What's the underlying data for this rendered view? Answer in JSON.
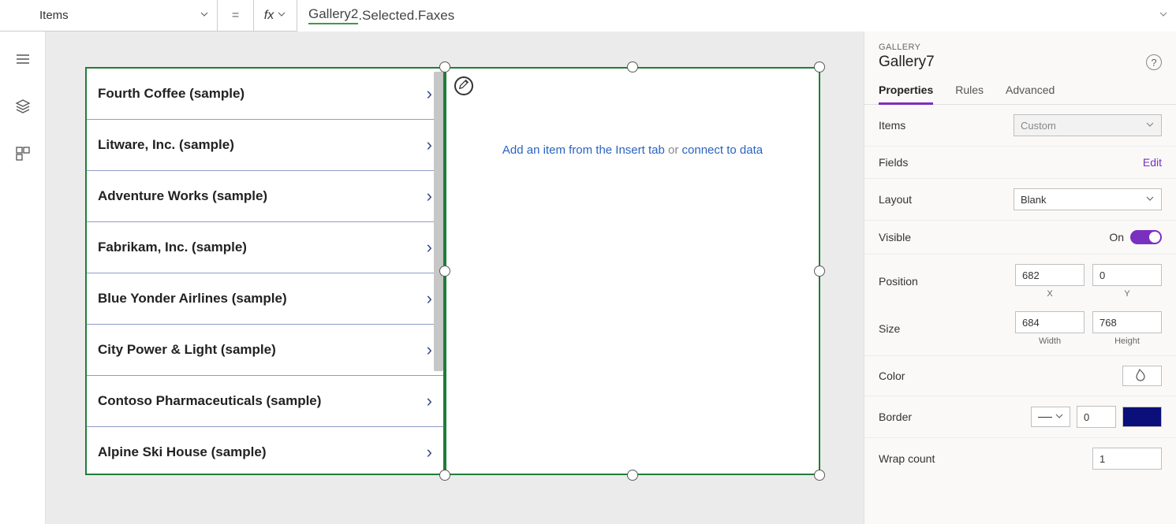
{
  "formula_bar": {
    "property": "Items",
    "equals": "=",
    "fx": "fx",
    "expr_ref": "Gallery2",
    "expr_rest": ".Selected.Faxes"
  },
  "gallery_list": {
    "items": [
      "Fourth Coffee (sample)",
      "Litware, Inc. (sample)",
      "Adventure Works (sample)",
      "Fabrikam, Inc. (sample)",
      "Blue Yonder Airlines (sample)",
      "City Power & Light (sample)",
      "Contoso Pharmaceuticals (sample)",
      "Alpine Ski House (sample)"
    ]
  },
  "gallery_empty": {
    "link1": "Add an item from the Insert tab",
    "mid": " or ",
    "link2": "connect to data"
  },
  "panel": {
    "section_label": "GALLERY",
    "control_name": "Gallery7",
    "tabs": {
      "properties": "Properties",
      "rules": "Rules",
      "advanced": "Advanced"
    },
    "items_label": "Items",
    "items_value": "Custom",
    "fields_label": "Fields",
    "fields_edit": "Edit",
    "layout_label": "Layout",
    "layout_value": "Blank",
    "visible_label": "Visible",
    "visible_value": "On",
    "position_label": "Position",
    "position_x": "682",
    "position_y": "0",
    "pos_x_sub": "X",
    "pos_y_sub": "Y",
    "size_label": "Size",
    "size_w": "684",
    "size_h": "768",
    "size_w_sub": "Width",
    "size_h_sub": "Height",
    "color_label": "Color",
    "border_label": "Border",
    "border_width": "0",
    "wrap_label": "Wrap count",
    "wrap_value": "1",
    "colors": {
      "border_swatch": "#0b0f7a"
    }
  }
}
